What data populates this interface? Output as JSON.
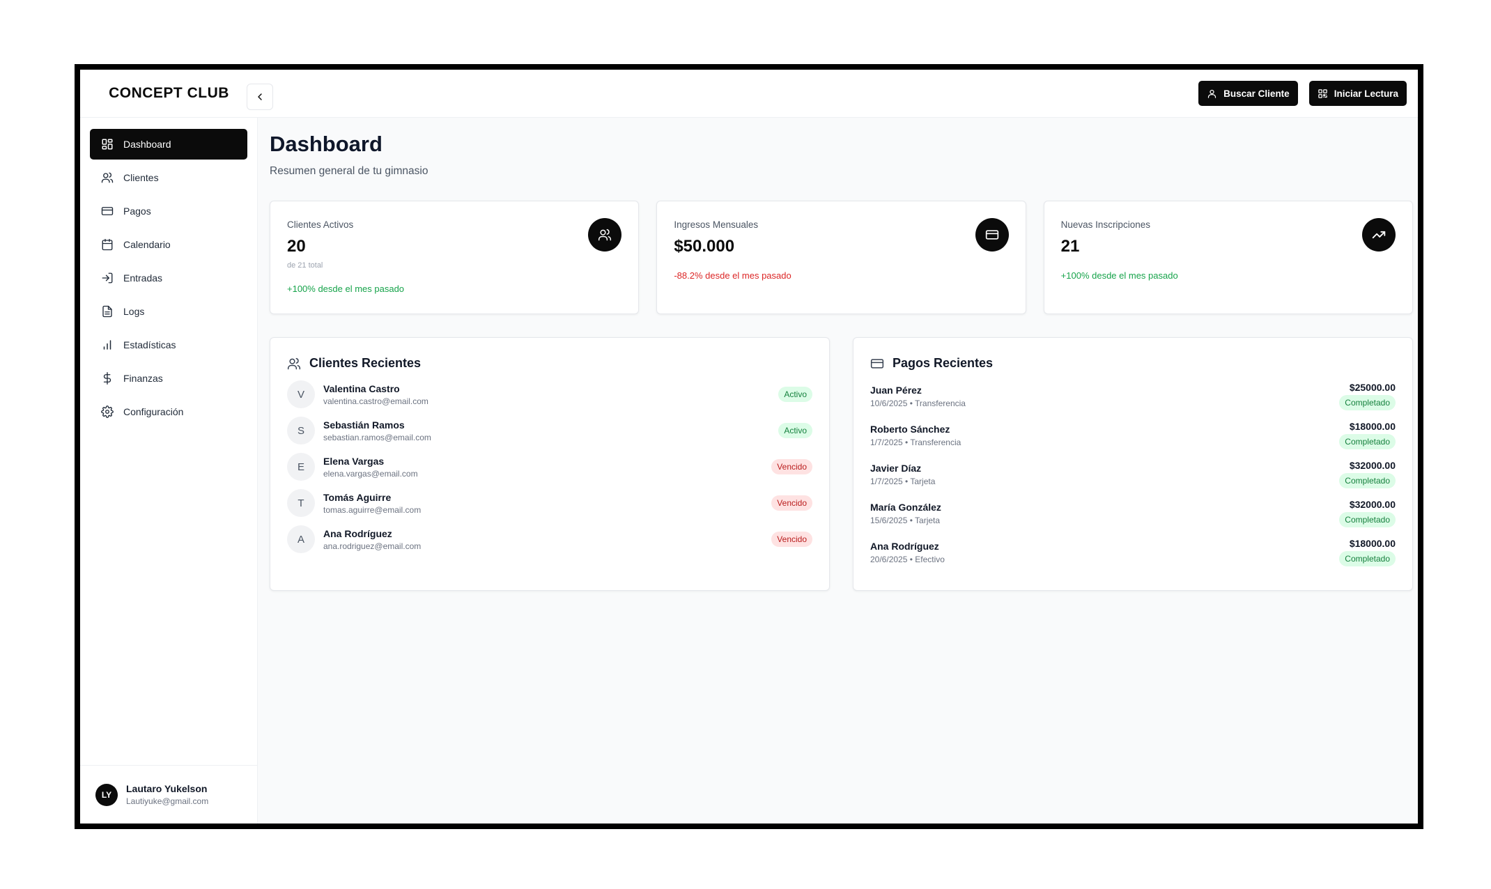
{
  "app": {
    "brand": "CONCEPT CLUB"
  },
  "topbar": {
    "search_client_label": "Buscar Cliente",
    "start_reading_label": "Iniciar Lectura"
  },
  "sidebar": {
    "items": [
      {
        "label": "Dashboard",
        "icon": "dashboard-icon",
        "active": true
      },
      {
        "label": "Clientes",
        "icon": "users-icon"
      },
      {
        "label": "Pagos",
        "icon": "credit-card-icon"
      },
      {
        "label": "Calendario",
        "icon": "calendar-icon"
      },
      {
        "label": "Entradas",
        "icon": "login-icon"
      },
      {
        "label": "Logs",
        "icon": "file-text-icon"
      },
      {
        "label": "Estadísticas",
        "icon": "bar-chart-icon"
      },
      {
        "label": "Finanzas",
        "icon": "dollar-icon"
      },
      {
        "label": "Configuración",
        "icon": "gear-icon"
      }
    ],
    "user": {
      "initials": "LY",
      "name": "Lautaro Yukelson",
      "email": "Lautiyuke@gmail.com"
    }
  },
  "main": {
    "title": "Dashboard",
    "subtitle": "Resumen general de tu gimnasio",
    "stats": [
      {
        "label": "Clientes Activos",
        "value": "20",
        "sub": "de 21 total",
        "change": "+100% desde el mes pasado",
        "trend": "up",
        "icon": "users-icon"
      },
      {
        "label": "Ingresos Mensuales",
        "value": "$50.000",
        "change": "-88.2% desde el mes pasado",
        "trend": "down",
        "icon": "credit-card-icon"
      },
      {
        "label": "Nuevas Inscripciones",
        "value": "21",
        "change": "+100% desde el mes pasado",
        "trend": "up",
        "icon": "trending-up-icon"
      }
    ],
    "recent_clients": {
      "title": "Clientes Recientes",
      "items": [
        {
          "initial": "V",
          "name": "Valentina Castro",
          "email": "valentina.castro@email.com",
          "status": "Activo"
        },
        {
          "initial": "S",
          "name": "Sebastián Ramos",
          "email": "sebastian.ramos@email.com",
          "status": "Activo"
        },
        {
          "initial": "E",
          "name": "Elena Vargas",
          "email": "elena.vargas@email.com",
          "status": "Vencido"
        },
        {
          "initial": "T",
          "name": "Tomás Aguirre",
          "email": "tomas.aguirre@email.com",
          "status": "Vencido"
        },
        {
          "initial": "A",
          "name": "Ana Rodríguez",
          "email": "ana.rodriguez@email.com",
          "status": "Vencido"
        }
      ]
    },
    "recent_payments": {
      "title": "Pagos Recientes",
      "items": [
        {
          "name": "Juan Pérez",
          "meta": "10/6/2025 • Transferencia",
          "amount": "$25000.00",
          "status": "Completado"
        },
        {
          "name": "Roberto Sánchez",
          "meta": "1/7/2025 • Transferencia",
          "amount": "$18000.00",
          "status": "Completado"
        },
        {
          "name": "Javier Díaz",
          "meta": "1/7/2025 • Tarjeta",
          "amount": "$32000.00",
          "status": "Completado"
        },
        {
          "name": "María González",
          "meta": "15/6/2025 • Tarjeta",
          "amount": "$32000.00",
          "status": "Completado"
        },
        {
          "name": "Ana Rodríguez",
          "meta": "20/6/2025 • Efectivo",
          "amount": "$18000.00",
          "status": "Completado"
        }
      ]
    }
  },
  "colors": {
    "accent": "#0b0b0b",
    "positive": "#16a34a",
    "negative": "#dc2626",
    "badge_green_bg": "#dcfce7",
    "badge_red_bg": "#fee2e2"
  }
}
